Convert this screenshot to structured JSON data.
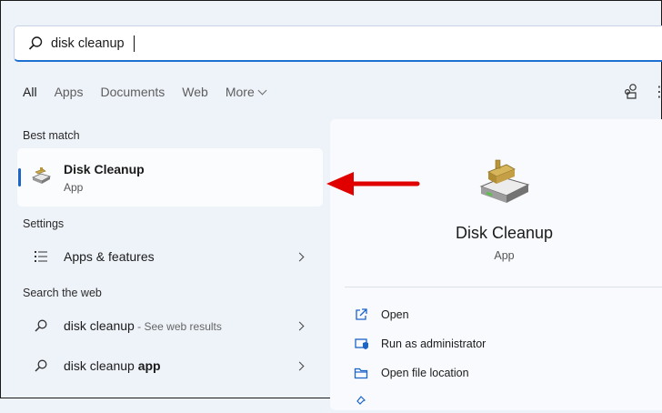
{
  "search": {
    "value": "disk cleanup"
  },
  "tabs": [
    {
      "label": "All"
    },
    {
      "label": "Apps"
    },
    {
      "label": "Documents"
    },
    {
      "label": "Web"
    },
    {
      "label": "More"
    }
  ],
  "sections": {
    "best_match": "Best match",
    "settings": "Settings",
    "web": "Search the web"
  },
  "best_match": {
    "title": "Disk Cleanup",
    "subtitle": "App"
  },
  "settings_items": [
    {
      "label": "Apps & features"
    }
  ],
  "web_items": [
    {
      "query": "disk cleanup",
      "suffix": " - See web results"
    },
    {
      "query": "disk cleanup ",
      "bold": "app"
    }
  ],
  "preview": {
    "title": "Disk Cleanup",
    "subtitle": "App",
    "actions": [
      {
        "label": "Open",
        "icon": "open-icon"
      },
      {
        "label": "Run as administrator",
        "icon": "shield-icon"
      },
      {
        "label": "Open file location",
        "icon": "folder-icon"
      }
    ]
  },
  "colors": {
    "accent": "#1b64c8",
    "arrow": "#e00000",
    "background": "#eef2f9"
  }
}
